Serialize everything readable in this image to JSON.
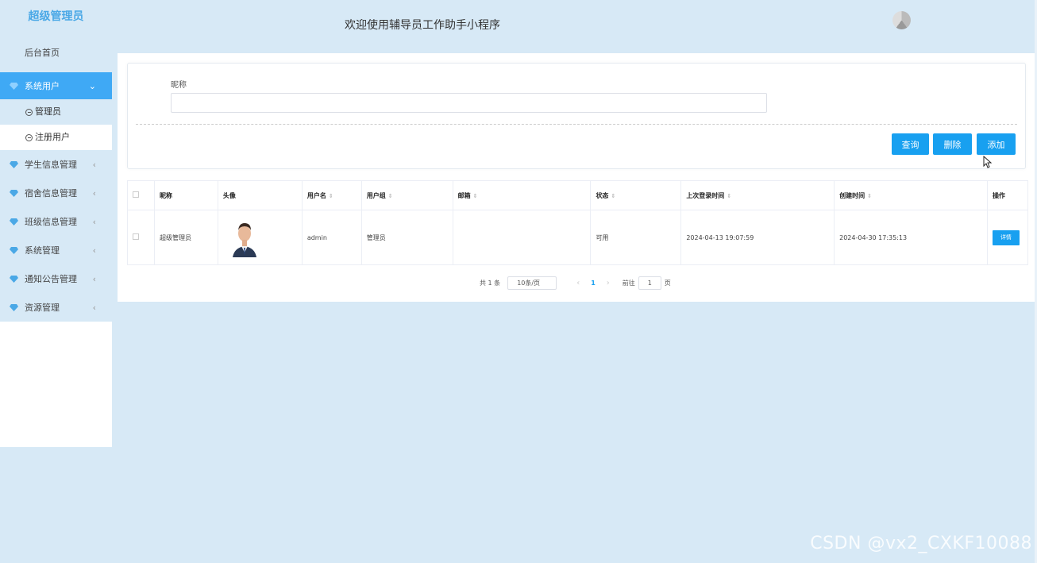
{
  "sidebar": {
    "title": "超级管理员",
    "home": "后台首页",
    "items": [
      {
        "label": "系统用户",
        "active": true,
        "arrow": "⌄"
      },
      {
        "label": "学生信息管理",
        "arrow": "‹"
      },
      {
        "label": "宿舍信息管理",
        "arrow": "‹"
      },
      {
        "label": "班级信息管理",
        "arrow": "‹"
      },
      {
        "label": "系统管理",
        "arrow": "‹"
      },
      {
        "label": "通知公告管理",
        "arrow": "‹"
      },
      {
        "label": "资源管理",
        "arrow": "‹"
      }
    ],
    "sub_items": [
      {
        "label": "管理员"
      },
      {
        "label": "注册用户",
        "selected": true
      }
    ]
  },
  "header": {
    "title": "欢迎使用辅导员工作助手小程序"
  },
  "search": {
    "label": "昵称",
    "value": "",
    "placeholder": ""
  },
  "buttons": {
    "query": "查询",
    "delete": "删除",
    "add": "添加"
  },
  "table": {
    "headers": [
      "昵称",
      "头像",
      "用户名",
      "用户组",
      "邮箱",
      "状态",
      "上次登录时间",
      "创建时间",
      "操作"
    ],
    "rows": [
      {
        "nickname": "超级管理员",
        "username": "admin",
        "group": "管理员",
        "email": "",
        "status": "可用",
        "last_login": "2024-04-13 19:07:59",
        "created": "2024-04-30 17:35:13",
        "action": "详情"
      }
    ]
  },
  "pagination": {
    "total": "共 1 条",
    "page_size": "10条/页",
    "current_page": "1",
    "goto_label": "前往",
    "goto_value": "1",
    "page_suffix": "页"
  },
  "watermark": "CSDN @vx2_CXKF10088",
  "colors": {
    "accent": "#18a0f0",
    "background": "#d7e9f6",
    "sidebar_active": "#3fa9f5"
  }
}
